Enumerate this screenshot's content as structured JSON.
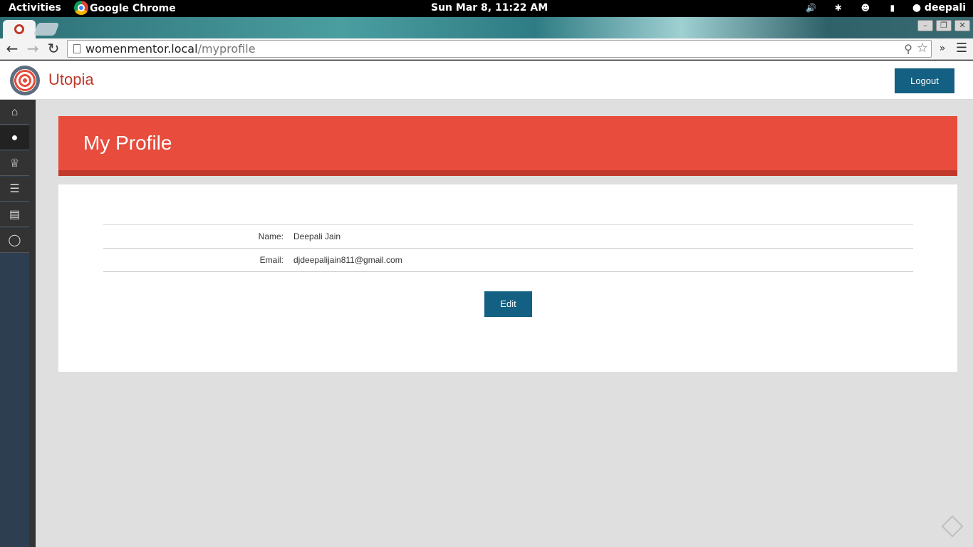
{
  "system": {
    "activities": "Activities",
    "app_name": "Google Chrome",
    "clock": "Sun Mar  8, 11:22 AM",
    "user": "deepali",
    "tray_icons": [
      "volume-icon",
      "bluetooth-icon",
      "wifi-icon",
      "battery-icon"
    ]
  },
  "browser": {
    "url_host": "womenmentor.local",
    "url_path": "/myprofile"
  },
  "site": {
    "brand": "Utopia",
    "logout_label": "Logout",
    "brand_color": "#c0392b",
    "accent_color": "#136082"
  },
  "sidebar": {
    "items": [
      {
        "icon": "home-icon",
        "active": false
      },
      {
        "icon": "user-icon",
        "active": true
      },
      {
        "icon": "trophy-icon",
        "active": false
      },
      {
        "icon": "list-icon",
        "active": false
      },
      {
        "icon": "chart-icon",
        "active": false
      },
      {
        "icon": "lightbulb-icon",
        "active": false
      }
    ]
  },
  "profile": {
    "title": "My Profile",
    "fields": [
      {
        "label": "Name:",
        "value": "Deepali Jain"
      },
      {
        "label": "Email:",
        "value": "djdeepalijain811@gmail.com"
      }
    ],
    "edit_label": "Edit"
  }
}
